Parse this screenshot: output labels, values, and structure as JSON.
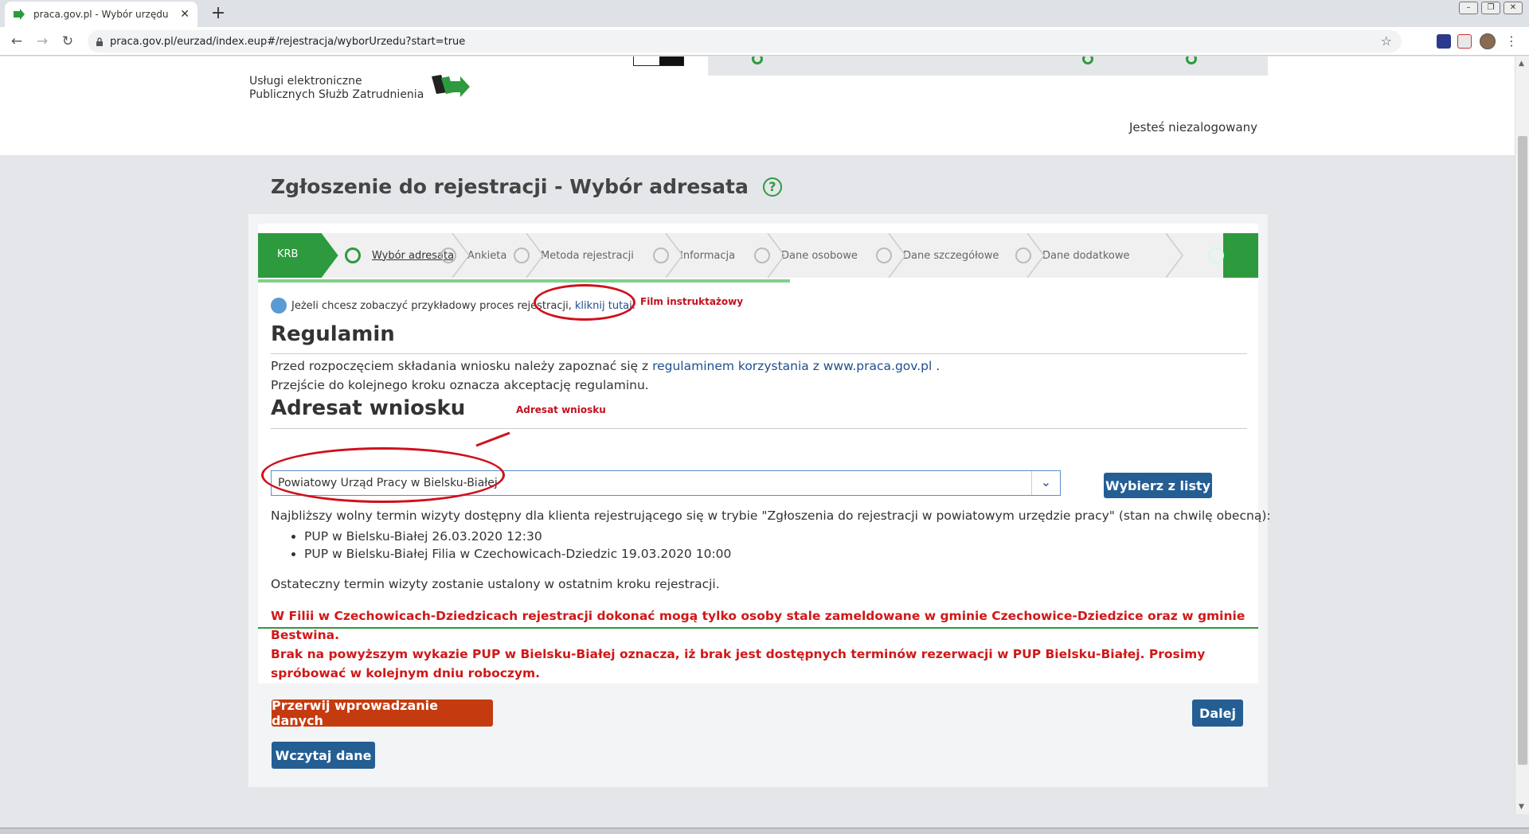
{
  "browser": {
    "tab_title": "praca.gov.pl - Wybór urzędu",
    "tab_close": "✕",
    "new_tab": "+",
    "url": "praca.gov.pl/eurzad/index.eup#/rejestracja/wyborUrzedu?start=true"
  },
  "header": {
    "logo_line1": "Usługi elektroniczne",
    "logo_line2": "Publicznych Służb Zatrudnienia",
    "user_status": "Jesteś niezalogowany"
  },
  "page": {
    "title": "Zgłoszenie do rejestracji - Wybór adresata",
    "help": "?"
  },
  "steps": {
    "krb": "KRB",
    "items": [
      "Wybór adresata",
      "Ankieta",
      "Metoda rejestracji",
      "Informacja",
      "Dane osobowe",
      "Dane szczegółowe",
      "Dane dodatkowe"
    ],
    "active_index": 0
  },
  "film": {
    "text": "Jeżeli chcesz zobaczyć przykładowy proces rejestracji,",
    "link": "kliknij tutaj.",
    "annotation": "Film instruktażowy"
  },
  "regulamin": {
    "heading": "Regulamin",
    "line1_prefix": "Przed rozpoczęciem składania wniosku należy zapoznać się z ",
    "line1_link": "regulaminem korzystania z www.praca.gov.pl",
    "line1_suffix": " .",
    "line2": "Przejście do kolejnego kroku oznacza akceptację regulaminu."
  },
  "adresat": {
    "heading": "Adresat wniosku",
    "annotation": "Adresat wniosku",
    "selected": "Powiatowy Urząd Pracy w Bielsku-Białej",
    "choose_button": "Wybierz z listy"
  },
  "info": {
    "nearest": "Najbliższy wolny termin wizyty dostępny dla klienta rejestrującego się w trybie \"Zgłoszenia do rejestracji w powiatowym urzędzie pracy\" (stan na chwilę obecną):",
    "items": [
      "PUP w Bielsku-Białej 26.03.2020 12:30",
      "PUP w Bielsku-Białej Filia w Czechowicach-Dziedzic 19.03.2020 10:00"
    ],
    "final": "Ostateczny termin wizyty zostanie ustalony w ostatnim kroku rejestracji.",
    "warning1": "W Filii w Czechowicach-Dziedzicach rejestracji dokonać mogą tylko osoby stale zameldowane w gminie Czechowice-Dziedzice oraz w gminie Bestwina.",
    "warning2": "Brak na powyższym wykazie PUP w Bielsku-Białej oznacza, iż brak jest dostępnych terminów rezerwacji w PUP Bielsku-Białej. Prosimy spróbować w kolejnym dniu roboczym."
  },
  "actions": {
    "abort": "Przerwij wprowadzanie danych",
    "next": "Dalej",
    "load": "Wczytaj dane"
  },
  "colors": {
    "green": "#2e9a3e",
    "blue_button": "#245e93",
    "red_button": "#c53b10",
    "warning_red": "#d01818"
  }
}
